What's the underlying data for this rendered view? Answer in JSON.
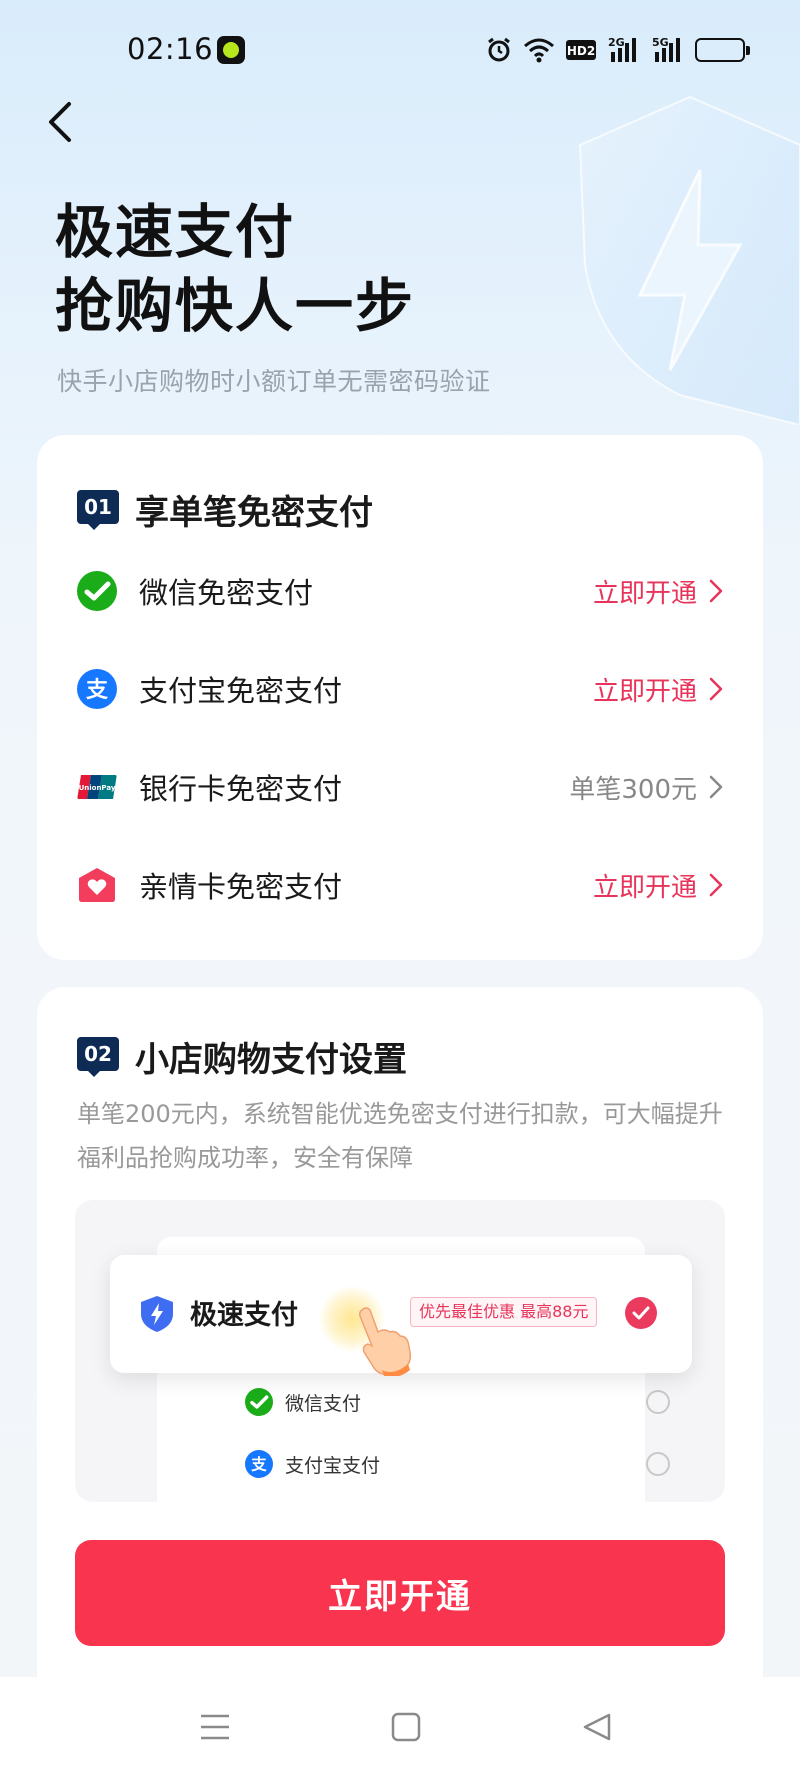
{
  "status_bar": {
    "time": "02:16",
    "icons": [
      "alarm-icon",
      "wifi-icon",
      "hd2-icon",
      "signal-2g-icon",
      "signal-5g-icon",
      "battery-icon"
    ],
    "hd_label": "HD2",
    "net1": "2G",
    "net2": "5G",
    "battery_level": 0.9
  },
  "header": {
    "back_icon": "chevron-left-icon",
    "title_line1": "极速支付",
    "title_line2": "抢购快人一步",
    "subtitle": "快手小店购物时小额订单无需密码验证"
  },
  "section1": {
    "badge": "01",
    "title": "享单笔免密支付",
    "items": [
      {
        "icon": "wechat-pay-icon",
        "label": "微信免密支付",
        "action": "立即开通",
        "muted": false
      },
      {
        "icon": "alipay-icon",
        "label": "支付宝免密支付",
        "action": "立即开通",
        "muted": false
      },
      {
        "icon": "unionpay-icon",
        "label": "银行卡免密支付",
        "action": "单笔300元",
        "muted": true
      },
      {
        "icon": "family-card-icon",
        "label": "亲情卡免密支付",
        "action": "立即开通",
        "muted": false
      }
    ]
  },
  "section2": {
    "badge": "02",
    "title": "小店购物支付设置",
    "description": "单笔200元内，系统智能优选免密支付进行扣款，可大幅提升福利品抢购成功率，安全有保障",
    "demo": {
      "selected_title": "极速支付",
      "selected_tag": "优先最佳优惠 最高88元",
      "options": [
        {
          "icon": "wechat-pay-icon",
          "label": "微信支付"
        },
        {
          "icon": "alipay-icon",
          "label": "支付宝支付"
        }
      ]
    },
    "cta": "立即开通"
  },
  "nav_bar": {
    "icons": [
      "menu-icon",
      "home-icon",
      "back-triangle-icon"
    ]
  },
  "colors": {
    "accent": "#e8345a",
    "cta": "#f8344f",
    "badge": "#0e2b55",
    "wechat": "#1aad19",
    "alipay": "#1677ff"
  }
}
